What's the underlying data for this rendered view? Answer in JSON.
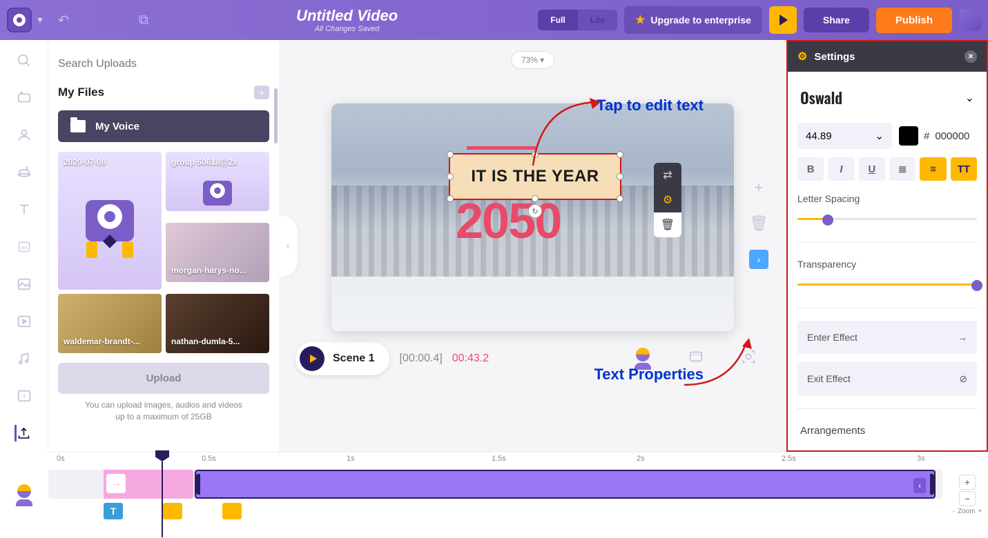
{
  "header": {
    "title": "Untitled Video",
    "subtitle": "All Changes Saved",
    "toggle": {
      "full": "Full",
      "lite": "Lite"
    },
    "upgrade": "Upgrade to enterprise",
    "share": "Share",
    "publish": "Publish"
  },
  "files": {
    "search_placeholder": "Search Uploads",
    "my_files": "My Files",
    "folder": "My Voice",
    "thumbs": [
      "2020-07-08",
      "group 50618@2x",
      "morgan-harys-no...",
      "waldemar-brandt-...",
      "nathan-dumla-5..."
    ],
    "upload": "Upload",
    "note_line1": "You can upload images, audios and videos",
    "note_line2": "up to a maximum of 25GB"
  },
  "canvas": {
    "zoom": "73% ▾",
    "textbox": "IT IS THE YEAR",
    "year": "2050",
    "annotation_edit": "Tap to edit text",
    "annotation_props": "Text Properties"
  },
  "scene_bar": {
    "label": "Scene 1",
    "current": "[00:00.4]",
    "total": "00:43.2"
  },
  "settings": {
    "title": "Settings",
    "font": "Oswald",
    "size": "44.89",
    "color": "000000",
    "hash": "#",
    "letter_spacing": "Letter Spacing",
    "transparency": "Transparency",
    "enter_effect": "Enter Effect",
    "exit_effect": "Exit Effect",
    "arrangements": "Arrangements"
  },
  "timeline": {
    "marks": [
      "0s",
      "0.5s",
      "1s",
      "1.5s",
      "2s",
      "2.5s",
      "3s"
    ],
    "zoom_label": "Zoom",
    "tag_t": "T"
  }
}
